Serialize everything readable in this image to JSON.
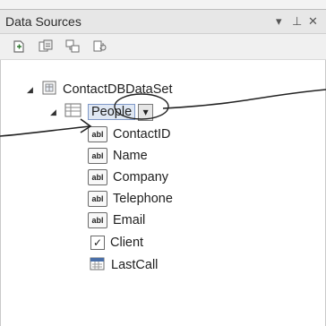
{
  "panel": {
    "title": "Data Sources",
    "controls": {
      "dropdown_icon": "chevron-down-icon",
      "pin_icon": "pin-icon",
      "close_icon": "close-icon",
      "dropdown_glyph": "▾",
      "pin_glyph": "⊥",
      "close_glyph": "✕"
    }
  },
  "toolbar": {
    "buttons": [
      {
        "name": "add-data-source-icon"
      },
      {
        "name": "edit-dataset-icon"
      },
      {
        "name": "configure-dataset-icon"
      },
      {
        "name": "refresh-icon"
      }
    ]
  },
  "tree": {
    "root": {
      "label": "ContactDBDataSet",
      "icon": "dataset-icon"
    },
    "table": {
      "label": "People",
      "icon": "table-grid-icon",
      "dropdown_glyph": "▾"
    },
    "fields": [
      {
        "label": "ContactID",
        "control": "abl"
      },
      {
        "label": "Name",
        "control": "abl"
      },
      {
        "label": "Company",
        "control": "abl"
      },
      {
        "label": "Telephone",
        "control": "abl"
      },
      {
        "label": "Email",
        "control": "abl"
      },
      {
        "label": "Client",
        "control": "checkbox",
        "glyph": "✓"
      },
      {
        "label": "LastCall",
        "control": "calendar"
      }
    ]
  }
}
